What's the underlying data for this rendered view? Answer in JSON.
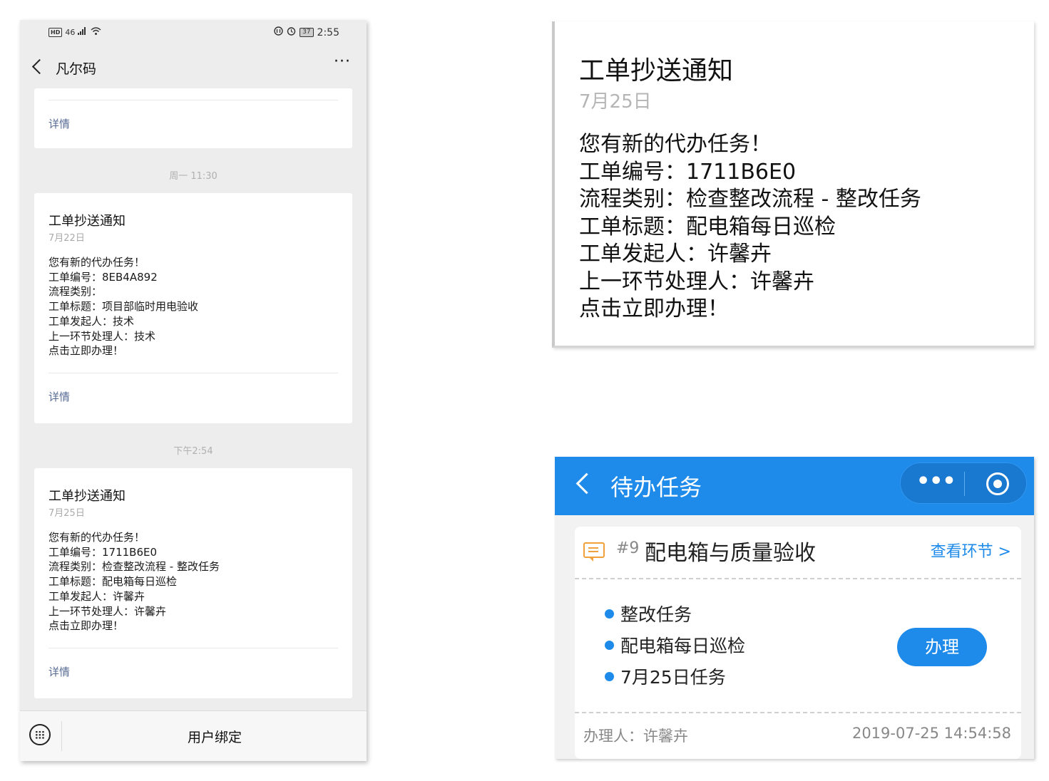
{
  "chat": {
    "status": {
      "left": "46",
      "time": "2:55",
      "battery": "37"
    },
    "title": "凡尔码",
    "more": "···",
    "first_card_detail": "详情",
    "timestamps": [
      "周一 11:30",
      "下午2:54"
    ],
    "cards": [
      {
        "title": "工单抄送通知",
        "date": "7月22日",
        "body": "您有新的代办任务！\n工单编号：8EB4A892\n流程类别：\n工单标题：项目部临时用电验收\n工单发起人：技术\n上一环节处理人：技术\n点击立即办理！",
        "detail": "详情"
      },
      {
        "title": "工单抄送通知",
        "date": "7月25日",
        "body": "您有新的代办任务！\n工单编号：1711B6E0\n流程类别：检查整改流程 - 整改任务\n工单标题：配电箱每日巡检\n工单发起人：许馨卉\n上一环节处理人：许馨卉\n点击立即办理！",
        "detail": "详情"
      }
    ],
    "bottom_menu": "用户绑定"
  },
  "zoom": {
    "title": "工单抄送通知",
    "date": "7月25日",
    "body": "您有新的代办任务！\n工单编号：1711B6E0\n流程类别：检查整改流程 - 整改任务\n工单标题：配电箱每日巡检\n工单发起人：许馨卉\n上一环节处理人：许馨卉\n点击立即办理！"
  },
  "mini": {
    "header_title": "待办任务",
    "capsule_more": "•••",
    "task": {
      "number": "#9",
      "title": "配电箱与质量验收",
      "link": "查看环节 >",
      "items": [
        "整改任务",
        "配电箱每日巡检",
        "7月25日任务"
      ],
      "action": "办理",
      "handler": "办理人：许馨卉",
      "time": "2019-07-25 14:54:58"
    },
    "accent_color": "#1e8bea"
  }
}
